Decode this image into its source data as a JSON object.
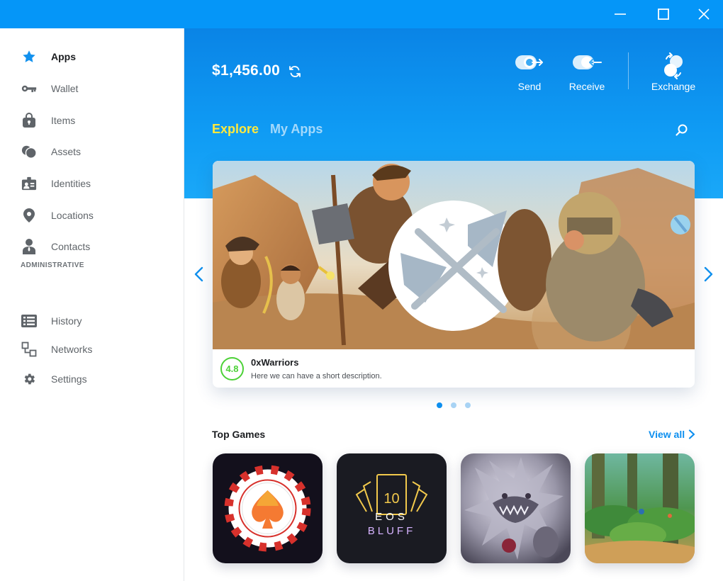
{
  "window": {
    "controls": [
      {
        "name": "minimize-button",
        "icon": "minimize-icon"
      },
      {
        "name": "maximize-button",
        "icon": "maximize-icon"
      },
      {
        "name": "close-button",
        "icon": "close-icon"
      }
    ]
  },
  "sidebar": {
    "items": [
      {
        "label": "Apps",
        "icon": "star-icon",
        "active": true
      },
      {
        "label": "Wallet",
        "icon": "key-icon"
      },
      {
        "label": "Items",
        "icon": "bag-icon"
      },
      {
        "label": "Assets",
        "icon": "coins-icon"
      },
      {
        "label": "Identities",
        "icon": "id-card-icon"
      },
      {
        "label": "Locations",
        "icon": "location-pin-icon"
      },
      {
        "label": "Contacts",
        "icon": "person-icon"
      }
    ],
    "section_label": "ADMINISTRATIVE",
    "admin_items": [
      {
        "label": "History",
        "icon": "list-icon"
      },
      {
        "label": "Networks",
        "icon": "network-icon"
      },
      {
        "label": "Settings",
        "icon": "gear-icon"
      }
    ]
  },
  "header": {
    "balance": "$1,456.00",
    "actions": {
      "send": "Send",
      "receive": "Receive",
      "exchange": "Exchange"
    },
    "tabs": [
      "Explore",
      "My Apps"
    ],
    "active_tab": "Explore"
  },
  "featured": {
    "rating": "4.8",
    "title": "0xWarriors",
    "description": "Here we can have a short description.",
    "slide_count": 3,
    "active_slide": 1
  },
  "top_games": {
    "title": "Top Games",
    "view_all": "View all",
    "games": [
      {
        "art": "poker-chip"
      },
      {
        "art": "eos-bluff",
        "card_value": "10",
        "line1": "EOS",
        "line2": "BLUFF"
      },
      {
        "art": "dragon"
      },
      {
        "art": "forest"
      }
    ]
  },
  "colors": {
    "accent": "#0d8fef",
    "titlebar": "#0596f8",
    "active_tab": "#ffe93d",
    "rating": "#4cd137"
  }
}
